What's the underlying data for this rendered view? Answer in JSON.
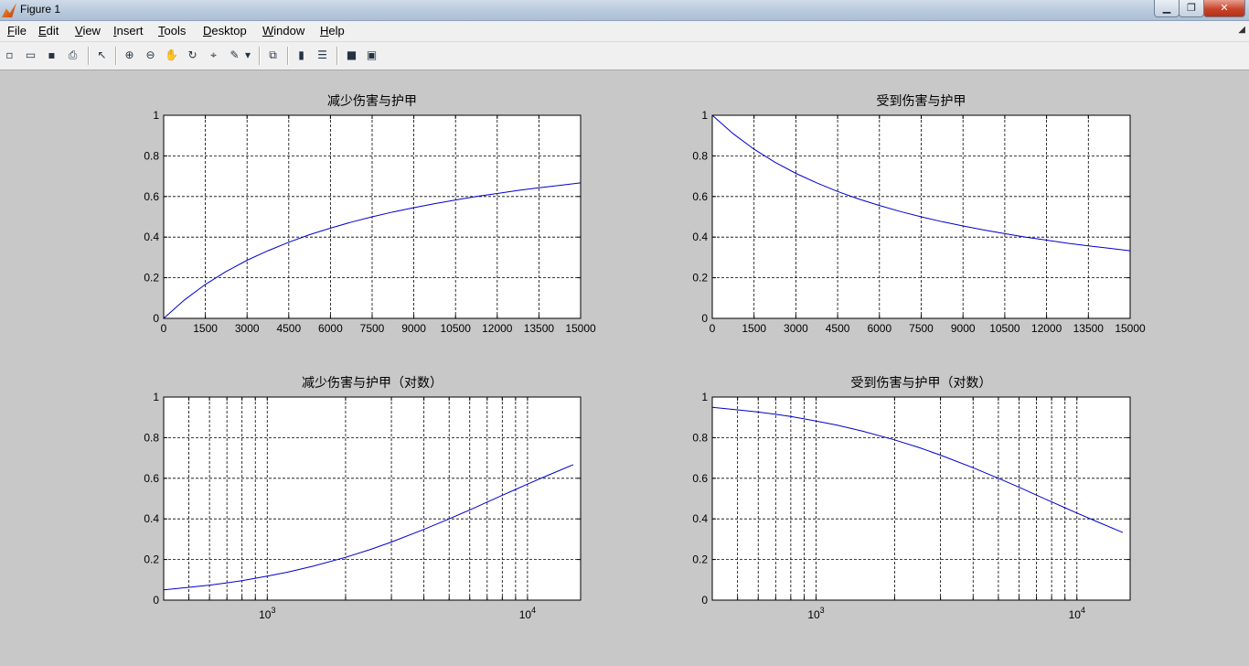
{
  "window": {
    "title": "Figure 1",
    "minimize_label": "▁",
    "maximize_label": "❐",
    "close_label": "✕"
  },
  "menu": {
    "items": [
      "File",
      "Edit",
      "View",
      "Insert",
      "Tools",
      "Desktop",
      "Window",
      "Help"
    ]
  },
  "toolbar": {
    "buttons": [
      {
        "name": "new-figure-icon",
        "glyph": "▫"
      },
      {
        "name": "open-file-icon",
        "glyph": "▭"
      },
      {
        "name": "save-icon",
        "glyph": "▪"
      },
      {
        "name": "print-icon",
        "glyph": "⎙"
      },
      {
        "name": "edit-plot-icon",
        "glyph": "↖"
      },
      {
        "name": "zoom-in-icon",
        "glyph": "⊕"
      },
      {
        "name": "zoom-out-icon",
        "glyph": "⊖"
      },
      {
        "name": "pan-icon",
        "glyph": "✋"
      },
      {
        "name": "rotate-3d-icon",
        "glyph": "↻"
      },
      {
        "name": "data-cursor-icon",
        "glyph": "⌖"
      },
      {
        "name": "brush-icon",
        "glyph": "✎"
      },
      {
        "name": "brush-dropdown-icon",
        "glyph": "▾"
      },
      {
        "name": "link-plot-icon",
        "glyph": "⧉"
      },
      {
        "name": "colorbar-icon",
        "glyph": "▮"
      },
      {
        "name": "legend-icon",
        "glyph": "☰"
      },
      {
        "name": "hide-plot-tools-icon",
        "glyph": "■"
      },
      {
        "name": "show-plot-tools-icon",
        "glyph": "▣"
      }
    ]
  },
  "colors": {
    "line": "#0000cc",
    "axes_bg": "#ffffff",
    "figure_bg": "#c8c8c8"
  },
  "chart_data": [
    {
      "type": "line",
      "title": "减少伤害与护甲",
      "xscale": "linear",
      "xlim": [
        0,
        15000
      ],
      "ylim": [
        0,
        1
      ],
      "xticks": [
        0,
        1500,
        3000,
        4500,
        6000,
        7500,
        9000,
        10500,
        12000,
        13500,
        15000
      ],
      "yticks": [
        0,
        0.2,
        0.4,
        0.6,
        0.8,
        1
      ],
      "grid": true,
      "series": [
        {
          "x": [
            0,
            750,
            1500,
            2250,
            3000,
            3750,
            4500,
            5250,
            6000,
            6750,
            7500,
            8250,
            9000,
            9750,
            10500,
            11250,
            12000,
            12750,
            13500,
            14250,
            15000
          ],
          "y": [
            0,
            0.091,
            0.167,
            0.231,
            0.286,
            0.333,
            0.375,
            0.412,
            0.444,
            0.474,
            0.5,
            0.524,
            0.545,
            0.565,
            0.583,
            0.6,
            0.615,
            0.63,
            0.643,
            0.655,
            0.667
          ]
        }
      ]
    },
    {
      "type": "line",
      "title": "受到伤害与护甲",
      "xscale": "linear",
      "xlim": [
        0,
        15000
      ],
      "ylim": [
        0,
        1
      ],
      "xticks": [
        0,
        1500,
        3000,
        4500,
        6000,
        7500,
        9000,
        10500,
        12000,
        13500,
        15000
      ],
      "yticks": [
        0,
        0.2,
        0.4,
        0.6,
        0.8,
        1
      ],
      "grid": true,
      "series": [
        {
          "x": [
            0,
            750,
            1500,
            2250,
            3000,
            3750,
            4500,
            5250,
            6000,
            6750,
            7500,
            8250,
            9000,
            9750,
            10500,
            11250,
            12000,
            12750,
            13500,
            14250,
            15000
          ],
          "y": [
            1,
            0.909,
            0.833,
            0.769,
            0.714,
            0.667,
            0.625,
            0.588,
            0.556,
            0.526,
            0.5,
            0.476,
            0.455,
            0.435,
            0.417,
            0.4,
            0.385,
            0.37,
            0.357,
            0.345,
            0.333
          ]
        }
      ]
    },
    {
      "type": "line",
      "title": "减少伤害与护甲（对数）",
      "xscale": "log",
      "xlim": [
        400,
        16000
      ],
      "ylim": [
        0,
        1
      ],
      "xtick_labels": [
        {
          "x": 1000,
          "base": "10",
          "exp": "3"
        },
        {
          "x": 10000,
          "base": "10",
          "exp": "4"
        }
      ],
      "grid_x": [
        500,
        600,
        700,
        800,
        900,
        1000,
        2000,
        3000,
        4000,
        5000,
        6000,
        7000,
        8000,
        9000,
        10000
      ],
      "yticks": [
        0,
        0.2,
        0.4,
        0.6,
        0.8,
        1
      ],
      "grid": true,
      "series": [
        {
          "x": [
            400,
            500,
            600,
            700,
            800,
            1000,
            1200,
            1500,
            2000,
            2500,
            3000,
            4000,
            5000,
            6000,
            7000,
            8000,
            9000,
            10000,
            12000,
            15000
          ],
          "y": [
            0.051,
            0.063,
            0.074,
            0.085,
            0.096,
            0.118,
            0.138,
            0.167,
            0.211,
            0.25,
            0.286,
            0.348,
            0.4,
            0.444,
            0.483,
            0.516,
            0.545,
            0.571,
            0.615,
            0.667
          ]
        }
      ]
    },
    {
      "type": "line",
      "title": "受到伤害与护甲（对数）",
      "xscale": "log",
      "xlim": [
        400,
        16000
      ],
      "ylim": [
        0,
        1
      ],
      "xtick_labels": [
        {
          "x": 1000,
          "base": "10",
          "exp": "3"
        },
        {
          "x": 10000,
          "base": "10",
          "exp": "4"
        }
      ],
      "grid_x": [
        500,
        600,
        700,
        800,
        900,
        1000,
        2000,
        3000,
        4000,
        5000,
        6000,
        7000,
        8000,
        9000,
        10000
      ],
      "yticks": [
        0,
        0.2,
        0.4,
        0.6,
        0.8,
        1
      ],
      "grid": true,
      "series": [
        {
          "x": [
            400,
            500,
            600,
            700,
            800,
            1000,
            1200,
            1500,
            2000,
            2500,
            3000,
            4000,
            5000,
            6000,
            7000,
            8000,
            9000,
            10000,
            12000,
            15000
          ],
          "y": [
            0.949,
            0.937,
            0.926,
            0.915,
            0.904,
            0.882,
            0.862,
            0.833,
            0.789,
            0.75,
            0.714,
            0.652,
            0.6,
            0.556,
            0.517,
            0.484,
            0.455,
            0.429,
            0.385,
            0.333
          ]
        }
      ]
    }
  ]
}
